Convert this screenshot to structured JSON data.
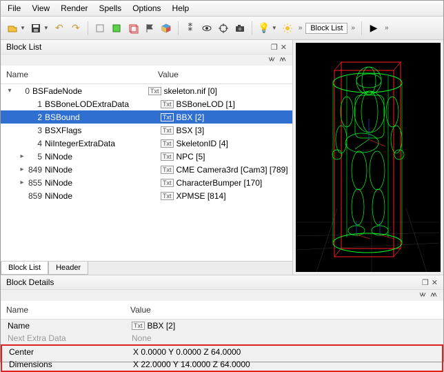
{
  "menu": {
    "file": "File",
    "view": "View",
    "render": "Render",
    "spells": "Spells",
    "options": "Options",
    "help": "Help"
  },
  "toolbar": {
    "blocklist_label": "Block List"
  },
  "blocklist": {
    "title": "Block List",
    "col_name": "Name",
    "col_value": "Value",
    "txt_badge": "Txt",
    "rows": [
      {
        "exp": "▾",
        "idx": "0",
        "name": "BSFadeNode",
        "val": "skeleton.nif [0]",
        "indent": 0
      },
      {
        "exp": "",
        "idx": "1",
        "name": "BSBoneLODExtraData",
        "val": "BSBoneLOD [1]",
        "indent": 1
      },
      {
        "exp": "",
        "idx": "2",
        "name": "BSBound",
        "val": "BBX [2]",
        "indent": 1,
        "sel": true
      },
      {
        "exp": "",
        "idx": "3",
        "name": "BSXFlags",
        "val": "BSX [3]",
        "indent": 1
      },
      {
        "exp": "",
        "idx": "4",
        "name": "NiIntegerExtraData",
        "val": "SkeletonID [4]",
        "indent": 1
      },
      {
        "exp": "▸",
        "idx": "5",
        "name": "NiNode",
        "val": "NPC [5]",
        "indent": 1
      },
      {
        "exp": "▸",
        "idx": "849",
        "name": "NiNode",
        "val": "CME Camera3rd [Cam3] [789]",
        "indent": 1
      },
      {
        "exp": "▸",
        "idx": "855",
        "name": "NiNode",
        "val": "CharacterBumper [170]",
        "indent": 1
      },
      {
        "exp": "",
        "idx": "859",
        "name": "NiNode",
        "val": "XPMSE [814]",
        "indent": 1
      }
    ],
    "tabs": {
      "blocklist": "Block List",
      "header": "Header"
    }
  },
  "details": {
    "title": "Block Details",
    "col_name": "Name",
    "col_value": "Value",
    "rows": [
      {
        "n": "Name",
        "badge": true,
        "v": "BBX [2]"
      },
      {
        "n": "Next Extra Data",
        "badge": false,
        "v": "None",
        "muted": true
      },
      {
        "n": "Center",
        "badge": false,
        "v": "X 0.0000 Y 0.0000 Z 64.0000",
        "hi": true
      },
      {
        "n": "Dimensions",
        "badge": false,
        "v": "X 22.0000 Y 14.0000 Z 64.0000",
        "hi": true
      }
    ]
  }
}
